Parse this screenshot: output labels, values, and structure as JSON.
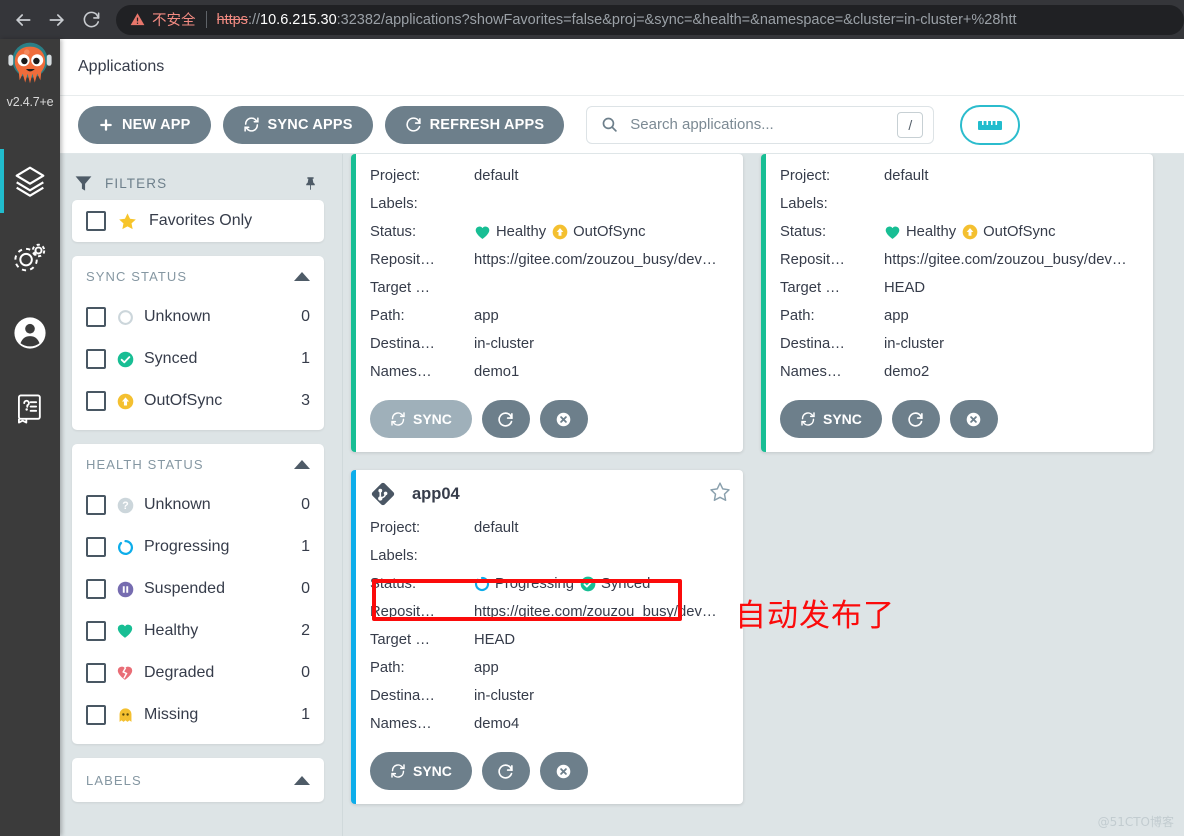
{
  "browser": {
    "back_label": "Back",
    "forward_label": "Forward",
    "reload_label": "Reload",
    "security_warning": "不安全",
    "url_scheme": "https",
    "url_sep": "://",
    "url_host": "10.6.215.30",
    "url_rest": ":32382/applications?showFavorites=false&proj=&sync=&health=&namespace=&cluster=in-cluster+%28htt"
  },
  "leftnav": {
    "version": "v2.4.7+e",
    "items": [
      {
        "name": "applications",
        "label": "Applications",
        "active": true
      },
      {
        "name": "settings",
        "label": "Settings",
        "active": false
      },
      {
        "name": "user-info",
        "label": "User Info",
        "active": false
      },
      {
        "name": "documentation",
        "label": "Documentation",
        "active": false
      }
    ]
  },
  "header": {
    "title": "Applications"
  },
  "toolbar": {
    "new_app": "NEW APP",
    "sync_apps": "SYNC APPS",
    "refresh_apps": "REFRESH APPS",
    "search_placeholder": "Search applications...",
    "search_value": "",
    "search_shortcut": "/",
    "view_toggle_label": "tiles-view"
  },
  "filters": {
    "title": "FILTERS",
    "pin_label": "pin",
    "favorites_only": "Favorites Only",
    "sections": [
      {
        "title": "SYNC STATUS",
        "collapsed": false,
        "rows": [
          {
            "label": "Unknown",
            "count": "0",
            "icon": "circle-outline",
            "color": "#ccd6db"
          },
          {
            "label": "Synced",
            "count": "1",
            "icon": "check-circle",
            "color": "#18be94"
          },
          {
            "label": "OutOfSync",
            "count": "3",
            "icon": "arrow-up-circle",
            "color": "#f4c030"
          }
        ]
      },
      {
        "title": "HEALTH STATUS",
        "collapsed": false,
        "rows": [
          {
            "label": "Unknown",
            "count": "0",
            "icon": "question-circle",
            "color": "#ccd6db"
          },
          {
            "label": "Progressing",
            "count": "1",
            "icon": "circle-outline",
            "color": "#0dadea"
          },
          {
            "label": "Suspended",
            "count": "0",
            "icon": "pause-circle",
            "color": "#766cb0"
          },
          {
            "label": "Healthy",
            "count": "2",
            "icon": "heart",
            "color": "#18be94"
          },
          {
            "label": "Degraded",
            "count": "0",
            "icon": "heart-broken",
            "color": "#e96d76"
          },
          {
            "label": "Missing",
            "count": "1",
            "icon": "ghost",
            "color": "#f4c030"
          }
        ]
      },
      {
        "title": "LABELS",
        "collapsed": false,
        "rows": []
      }
    ]
  },
  "cards": [
    {
      "name": "",
      "name_visible": false,
      "border_color": "#18be94",
      "project_key": "Project:",
      "project": "default",
      "labels_key": "Labels:",
      "labels": "",
      "status_key": "Status:",
      "health": "Healthy",
      "health_icon": "heart",
      "health_color": "#18be94",
      "sync": "OutOfSync",
      "sync_icon": "arrow-up-circle",
      "sync_color": "#f4c030",
      "repo_key": "Reposit…",
      "repo": "https://gitee.com/zouzou_busy/dev…",
      "target_key": "Target …",
      "target": "",
      "path_key": "Path:",
      "path": "app",
      "dest_key": "Destina…",
      "dest": "in-cluster",
      "ns_key": "Names…",
      "ns": "demo1",
      "sync_button": "SYNC",
      "sync_disabled": true
    },
    {
      "name": "",
      "name_visible": false,
      "border_color": "#18be94",
      "project_key": "Project:",
      "project": "default",
      "labels_key": "Labels:",
      "labels": "",
      "status_key": "Status:",
      "health": "Healthy",
      "health_icon": "heart",
      "health_color": "#18be94",
      "sync": "OutOfSync",
      "sync_icon": "arrow-up-circle",
      "sync_color": "#f4c030",
      "repo_key": "Reposit…",
      "repo": "https://gitee.com/zouzou_busy/dev…",
      "target_key": "Target …",
      "target": "HEAD",
      "path_key": "Path:",
      "path": "app",
      "dest_key": "Destina…",
      "dest": "in-cluster",
      "ns_key": "Names…",
      "ns": "demo2",
      "sync_button": "SYNC",
      "sync_disabled": false
    },
    {
      "name": "app04",
      "name_visible": true,
      "border_color": "#0dadea",
      "project_key": "Project:",
      "project": "default",
      "labels_key": "Labels:",
      "labels": "",
      "status_key": "Status:",
      "health": "Progressing",
      "health_icon": "circle-outline",
      "health_color": "#0dadea",
      "sync": "Synced",
      "sync_icon": "check-circle",
      "sync_color": "#18be94",
      "repo_key": "Reposit…",
      "repo": "https://gitee.com/zouzou_busy/dev…",
      "target_key": "Target …",
      "target": "HEAD",
      "path_key": "Path:",
      "path": "app",
      "dest_key": "Destina…",
      "dest": "in-cluster",
      "ns_key": "Names…",
      "ns": "demo4",
      "sync_button": "SYNC",
      "sync_disabled": false
    }
  ],
  "annotation": {
    "text": "自动发布了",
    "color": "#fb0b0b"
  },
  "watermark": "@51CTO博客"
}
